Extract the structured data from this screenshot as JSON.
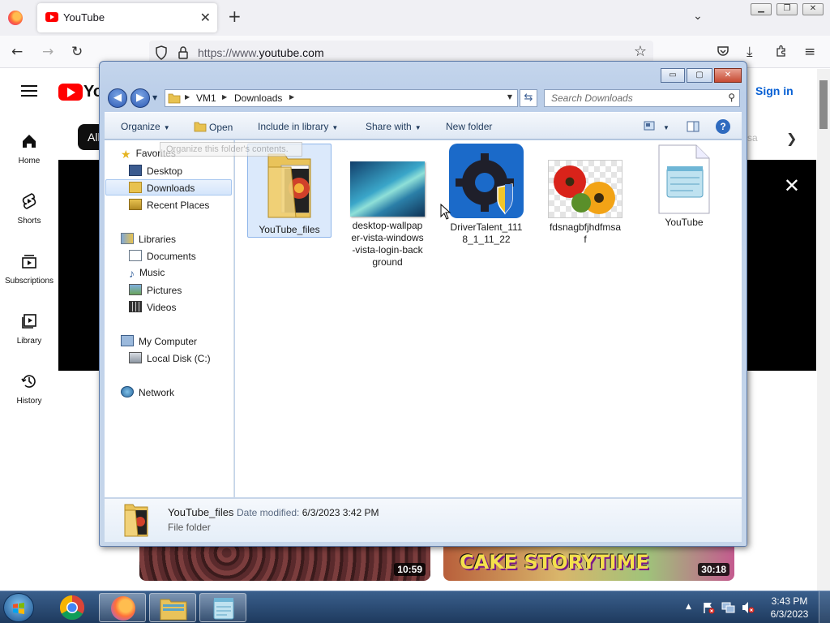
{
  "browser": {
    "tab_title": "YouTube",
    "tab_close": "✕",
    "new_tab": "+",
    "tab_list": "⌄",
    "url_prefix": "https://www.",
    "url_domain": "youtube.com",
    "window_buttons": [
      "▁",
      "❐",
      "✕"
    ]
  },
  "youtube": {
    "logo_text": "Yo",
    "sidebar": [
      {
        "label": "Home",
        "icon": "home-icon"
      },
      {
        "label": "Shorts",
        "icon": "shorts-icon"
      },
      {
        "label": "Subscriptions",
        "icon": "subscriptions-icon"
      },
      {
        "label": "Library",
        "icon": "library-icon"
      },
      {
        "label": "History",
        "icon": "history-icon"
      }
    ],
    "chip_all": "All",
    "sign_in": "Sign in",
    "faded_chip": "sa",
    "close_x": "✕",
    "durations": [
      "10:59",
      "30:18"
    ],
    "thumb2_title": "CAKE STORYTIME"
  },
  "explorer": {
    "caption_buttons": [
      "▭",
      "▢",
      "✕"
    ],
    "breadcrumb": [
      "VM1",
      "Downloads"
    ],
    "search_placeholder": "Search Downloads",
    "commands": {
      "organize": "Organize",
      "open": "Open",
      "include": "Include in library",
      "share": "Share with",
      "new_folder": "New folder"
    },
    "tooltip": "Organize this folder's contents.",
    "nav": {
      "favorites": "Favorites",
      "desktop": "Desktop",
      "downloads": "Downloads",
      "recent": "Recent Places",
      "libraries": "Libraries",
      "documents": "Documents",
      "music": "Music",
      "pictures": "Pictures",
      "videos": "Videos",
      "computer": "My Computer",
      "local_disk": "Local Disk (C:)",
      "network": "Network"
    },
    "files": [
      {
        "name": "YouTube_files",
        "icon": "folder-icon"
      },
      {
        "name": "desktop-wallpaper-vista-windows-vista-login-background",
        "icon": "image-thumbnail"
      },
      {
        "name": "DriverTalent_1118_1_11_22",
        "icon": "drivertalent-icon"
      },
      {
        "name": "fdsnagbfjhdfmsaf",
        "icon": "flowers-thumbnail"
      },
      {
        "name": "YouTube",
        "icon": "notepad-document-icon"
      }
    ],
    "details": {
      "name": "YouTube_files",
      "date_label": "Date modified:",
      "date_value": "6/3/2023 3:42 PM",
      "type": "File folder"
    }
  },
  "taskbar": {
    "time": "3:43 PM",
    "date": "6/3/2023",
    "show_hidden": "▲"
  }
}
